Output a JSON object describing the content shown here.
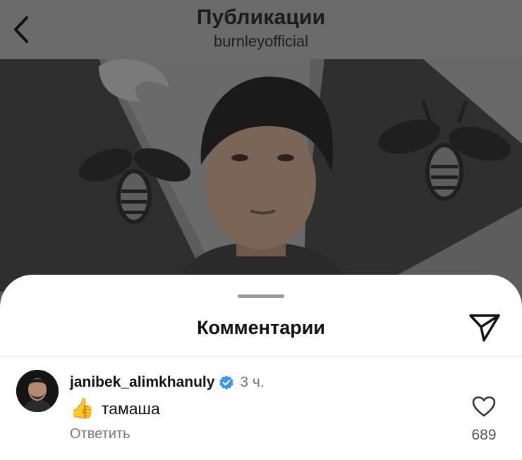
{
  "header": {
    "title": "Публикации",
    "subtitle": "burnleyofficial"
  },
  "icons": {
    "back": "chevron-left-icon",
    "share": "paper-plane-icon",
    "verified": "verified-badge-icon",
    "like": "heart-outline-icon"
  },
  "comments_sheet": {
    "title": "Комментарии",
    "comment": {
      "username": "janibek_alimkhanuly",
      "time": "3 ч.",
      "emoji": "👍",
      "text": "тамаша",
      "reply_label": "Ответить",
      "like_count": "689"
    }
  },
  "colors": {
    "verified": "#3897f0",
    "topbar": "#6b6b6b"
  }
}
